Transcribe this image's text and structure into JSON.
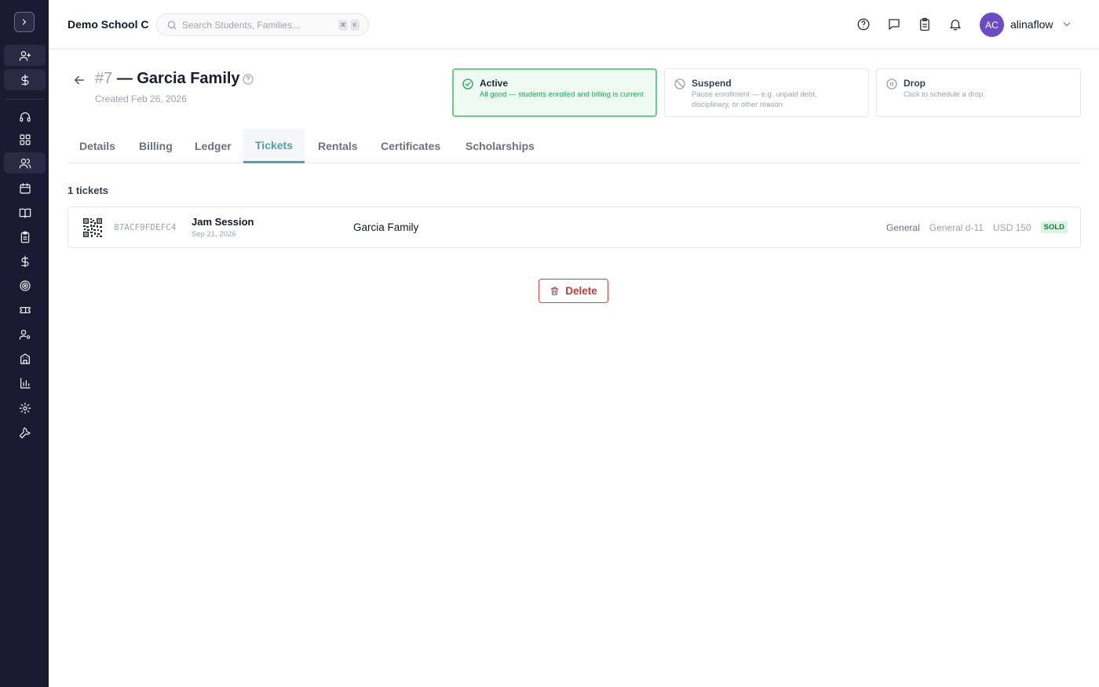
{
  "header": {
    "school_name": "Demo School C",
    "search_placeholder": "Search Students, Families...",
    "shortcut_keys": [
      "⌘",
      "K"
    ],
    "avatar_initials": "AC",
    "username": "alinaflow"
  },
  "sidebar": {
    "icons": [
      "add-user-icon",
      "dollar-icon",
      "headset-icon",
      "dashboard-icon",
      "users-icon",
      "calendar-icon",
      "book-icon",
      "clipboard-icon",
      "dollar-icon",
      "target-icon",
      "ticket-icon",
      "user-settings-icon",
      "building-icon",
      "bar-chart-icon",
      "gear-icon",
      "wrench-icon"
    ]
  },
  "family": {
    "number": "#7",
    "name": "— Garcia Family",
    "created": "Created Feb 26, 2026"
  },
  "statuses": [
    {
      "title": "Active",
      "desc": "All good — students enrolled and billing is current",
      "selected": true
    },
    {
      "title": "Suspend",
      "desc": "Pause enrollment — e.g. unpaid debt, disciplinary, or other reason",
      "selected": false
    },
    {
      "title": "Drop",
      "desc": "Click to schedule a drop.",
      "selected": false
    }
  ],
  "tabs": [
    "Details",
    "Billing",
    "Ledger",
    "Tickets",
    "Rentals",
    "Certificates",
    "Scholarships"
  ],
  "active_tab": "Tickets",
  "tickets": {
    "count_label": "1 tickets",
    "rows": [
      {
        "code": "87ACF9FDEFC4",
        "event": "Jam Session",
        "date": "Sep 21, 2026",
        "family": "Garcia Family",
        "category": "General",
        "seat": "General d-11",
        "price": "USD 150",
        "status": "SOLD"
      }
    ]
  },
  "actions": {
    "delete_label": "Delete"
  },
  "colors": {
    "sidebar_bg": "#1b1a33",
    "accent": "#4fa3a5",
    "active_green": "#22a35a",
    "danger": "#c43c3c",
    "avatar_bg": "#6d4bc2"
  }
}
